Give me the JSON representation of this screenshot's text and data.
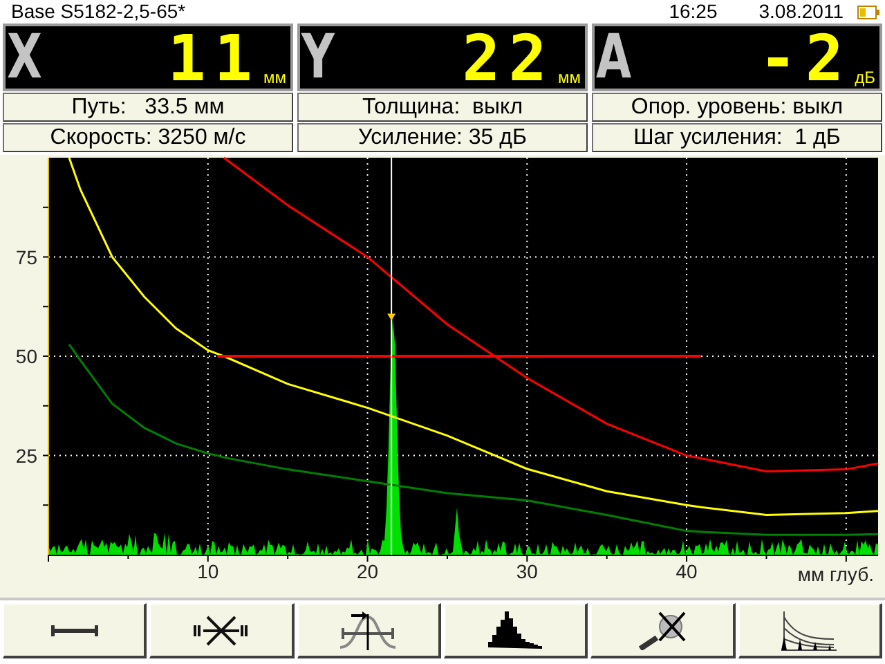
{
  "header": {
    "title": "Base S5182-2,5-65*",
    "time": "16:25",
    "date": "3.08.2011"
  },
  "readouts": [
    {
      "letter": "X",
      "value": "11",
      "unit": "мм"
    },
    {
      "letter": "Y",
      "value": "22",
      "unit": "мм"
    },
    {
      "letter": "A",
      "value": "-2",
      "unit": "дБ"
    }
  ],
  "info_rows": [
    {
      "cells": [
        "Путь:   33.5 мм",
        "Толщина:  выкл",
        "Опор. уровень: выкл"
      ]
    },
    {
      "cells": [
        "Скорость: 3250 м/с",
        "Усиление: 35 дБ",
        "Шаг усиления:  1 дБ"
      ]
    }
  ],
  "chart": {
    "chart_data": {
      "type": "line",
      "xlabel": "мм глуб.",
      "x": [
        1.3,
        2,
        4,
        6,
        8,
        10,
        10.6,
        11,
        15,
        20,
        25,
        30,
        35,
        40,
        40.9,
        45,
        50,
        52
      ],
      "series": [
        {
          "color": "#ff0000",
          "values": [
            null,
            null,
            null,
            null,
            null,
            null,
            null,
            100,
            88,
            75,
            58,
            44.5,
            33,
            25,
            24.3,
            21,
            21.5,
            23
          ]
        },
        {
          "color": "#ffff00",
          "values": [
            100,
            92,
            75,
            65,
            57,
            51.5,
            50.6,
            50,
            43,
            37,
            30,
            21.6,
            16,
            12.5,
            12,
            10,
            10.5,
            11
          ]
        },
        {
          "color": "#008000",
          "values": [
            53,
            49,
            38,
            32,
            28,
            25.5,
            25,
            24.5,
            21.5,
            18.5,
            15.5,
            13.7,
            10,
            6,
            5.8,
            5,
            5,
            5.2
          ]
        },
        {
          "color": "#ff0000",
          "values": [
            null,
            null,
            null,
            null,
            null,
            null,
            50,
            null,
            null,
            null,
            null,
            null,
            null,
            null,
            50,
            null,
            null,
            null
          ]
        }
      ],
      "ref_lines": [
        {
          "axis": "x",
          "value": 21.5,
          "color": "#ffffff"
        }
      ],
      "xlim": [
        0,
        52
      ],
      "ylim": [
        0,
        100
      ],
      "xticks": [
        10,
        20,
        30,
        40
      ],
      "yticks": [
        25,
        50,
        75
      ],
      "grid": true
    }
  }
}
